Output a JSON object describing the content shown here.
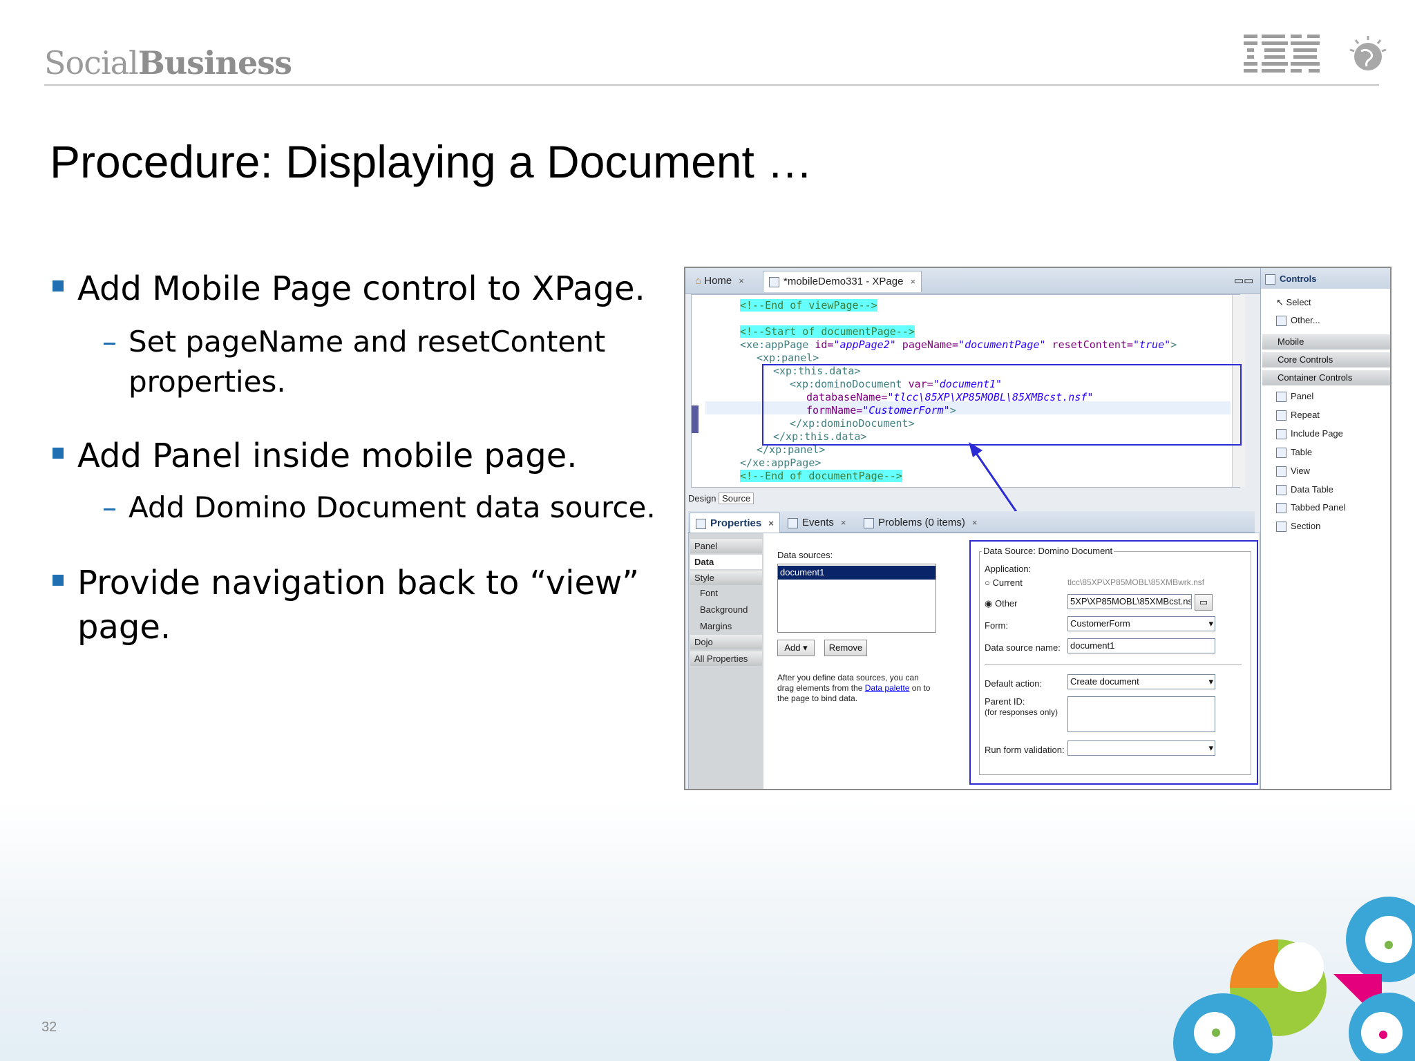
{
  "header": {
    "brand_light": "Social",
    "brand_bold": "Business",
    "logo": "IBM"
  },
  "title": "Procedure:  Displaying a Document …",
  "bullets": [
    {
      "text": "Add Mobile Page control to XPage.",
      "sub": [
        "Set pageName and resetContent",
        "properties."
      ]
    },
    {
      "text": "Add Panel inside mobile page.",
      "sub": [
        "Add Domino Document data source."
      ]
    },
    {
      "text": "Provide navigation back to “view”",
      "text2": "page."
    }
  ],
  "page_number": "32",
  "screenshot": {
    "tabs": {
      "home": "Home",
      "doc": "*mobileDemo331 - XPage"
    },
    "code": {
      "l0": "<!--End of viewPage-->",
      "l1": "<!--Start of documentPage-->",
      "l2_tag": "<xe:appPage ",
      "l2_a1": "id=",
      "l2_v1": "\"appPage2\"",
      "l2_a2": " pageName=",
      "l2_v2": "\"documentPage\"",
      "l2_a3": " resetContent=",
      "l2_v3": "\"true\"",
      "l2_end": ">",
      "l3": "<xp:panel>",
      "l4": "<xp:this.data>",
      "l5_tag": "<xp:dominoDocument ",
      "l5_a": "var=",
      "l5_v": "\"document1\"",
      "l6_a": "databaseName=",
      "l6_v": "\"tlcc\\85XP\\XP85MOBL\\85XMBcst.nsf\"",
      "l7_a": "formName=",
      "l7_v": "\"CustomerForm\"",
      "l7_end": ">",
      "l8": "</xp:dominoDocument>",
      "l9": "</xp:this.data>",
      "l10": "</xp:panel>",
      "l11": "</xe:appPage>",
      "l12": "<!--End of documentPage-->"
    },
    "editor_tabs": {
      "design": "Design",
      "source": "Source"
    },
    "props_tabs": {
      "properties": "Properties",
      "events": "Events",
      "problems": "Problems (0 items)"
    },
    "nav": [
      "Panel",
      "Data",
      "Style",
      "Font",
      "Background",
      "Margins",
      "Dojo",
      "All Properties"
    ],
    "data_sources_label": "Data sources:",
    "data_source_item": "document1",
    "add_btn": "Add",
    "remove_btn": "Remove",
    "help_text_1": "After you define data sources, you can",
    "help_text_2a": "drag elements from the ",
    "help_link": "Data palette",
    "help_text_2b": " on to",
    "help_text_3": "the page to bind data.",
    "ds_group": "Data Source: Domino Document",
    "application_label": "Application:",
    "current_label": "Current",
    "current_value": "tlcc\\85XP\\XP85MOBL\\85XMBwrk.nsf",
    "other_label": "Other",
    "other_value": "5XP\\XP85MOBL\\85XMBcst.nsf",
    "form_label": "Form:",
    "form_value": "CustomerForm",
    "dsname_label": "Data source name:",
    "dsname_value": "document1",
    "default_action_label": "Default action:",
    "default_action_value": "Create document",
    "parent_id_label": "Parent ID:",
    "parent_id_sub": "(for responses only)",
    "run_validation_label": "Run form validation:",
    "controls": {
      "title": "Controls",
      "select": "Select",
      "other": "Other...",
      "mobile": "Mobile",
      "core": "Core Controls",
      "container": "Container Controls",
      "items": [
        "Panel",
        "Repeat",
        "Include Page",
        "Table",
        "View",
        "Data Table",
        "Tabbed Panel",
        "Section"
      ]
    }
  }
}
